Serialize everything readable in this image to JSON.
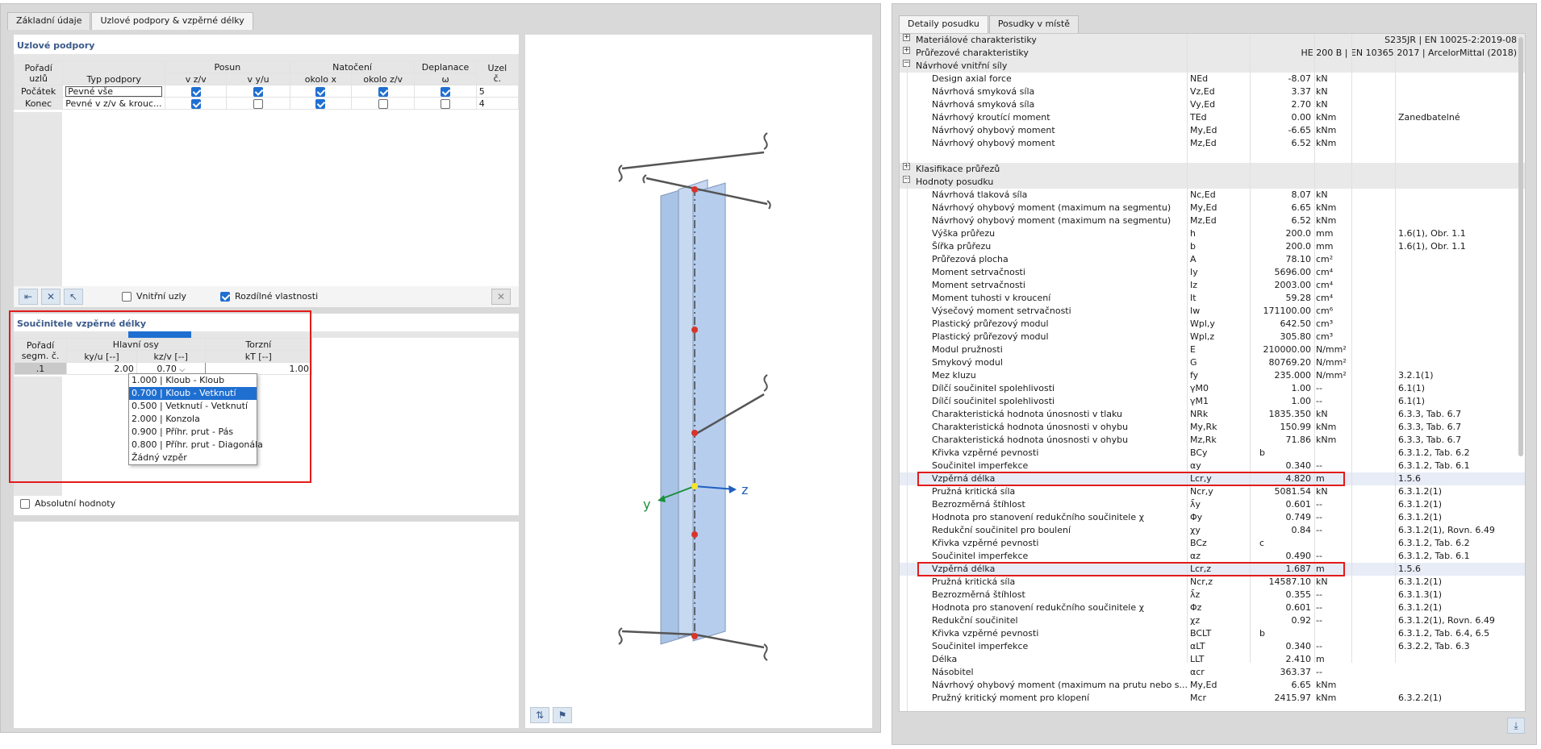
{
  "left": {
    "tabs": [
      "Základní údaje",
      "Uzlové podpory & vzpěrné délky"
    ],
    "supports_section_title": "Uzlové podpory",
    "supports_header": {
      "order": "Pořadí uzlů",
      "order_l1": "Pořadí",
      "order_l2": "uzlů",
      "type": "Typ podpory",
      "posun": "Posun",
      "natoceni": "Natočení",
      "deplanace": "Deplanace",
      "uzel_l1": "Uzel",
      "uzel_l2": "č.",
      "vzv": "v z/v",
      "vyu": "v y/u",
      "okolox": "okolo x",
      "okolozv": "okolo z/v",
      "omega": "ω"
    },
    "supports_rows": [
      {
        "label": "Počátek",
        "type": "Pevné vše",
        "c1": true,
        "c2": true,
        "c3": true,
        "c4": true,
        "c5": true,
        "node": "5"
      },
      {
        "label": "Konec",
        "type": "Pevné v z/v & krouc...",
        "c1": true,
        "c2": false,
        "c3": true,
        "c4": false,
        "c5": false,
        "node": "4"
      }
    ],
    "inner_nodes_label": "Vnitřní uzly",
    "inner_nodes_checked": false,
    "different_props_label": "Rozdílné vlastnosti",
    "different_props_checked": true,
    "buckling_section_title": "Součinitele vzpěrné délky",
    "buckling_header": {
      "order_l1": "Pořadí",
      "order_l2": "segm. č.",
      "main_axes": "Hlavní osy",
      "torsion": "Torzní",
      "ky": "ky/u [--]",
      "kz": "kz/v [--]",
      "kt": "kT [--]"
    },
    "buckling_row": {
      "no": ".1",
      "ky": "2.00",
      "kz": "0.70",
      "kt": "1.00"
    },
    "dropdown_options": [
      "1.000 | Kloub - Kloub",
      "0.700 | Kloub - Vetknutí",
      "0.500 | Vetknutí - Vetknutí",
      "2.000 | Konzola",
      "0.900 | Příhr. prut - Pás",
      "0.800 | Příhr. prut - Diagonála",
      "Žádný vzpěr"
    ],
    "dropdown_selected_index": 1,
    "absolute_values_label": "Absolutní hodnoty",
    "axis_y": "y",
    "axis_z": "z"
  },
  "right": {
    "tabs": [
      "Detaily posudku",
      "Posudky v místě"
    ],
    "rows": [
      {
        "kind": "group",
        "sign": "+",
        "name": "Materiálové charakteristiky",
        "right": "S235JR | EN 10025-2:2019-08"
      },
      {
        "kind": "group",
        "sign": "+",
        "name": "Průřezové charakteristiky",
        "right": "HE 200 B | EN 10365:2017 | ArcelorMittal (2018)"
      },
      {
        "kind": "group",
        "sign": "−",
        "name": "Návrhové vnitřní síly",
        "right": ""
      },
      {
        "kind": "row",
        "name": "Design axial force",
        "sym": "NEd",
        "val": "-8.07",
        "unit": "kN",
        "note": "",
        "ref": ""
      },
      {
        "kind": "row",
        "name": "Návrhová smyková síla",
        "sym": "Vz,Ed",
        "val": "3.37",
        "unit": "kN",
        "note": "",
        "ref": ""
      },
      {
        "kind": "row",
        "name": "Návrhová smyková síla",
        "sym": "Vy,Ed",
        "val": "2.70",
        "unit": "kN",
        "note": "",
        "ref": ""
      },
      {
        "kind": "row",
        "name": "Návrhový kroutící moment",
        "sym": "TEd",
        "val": "0.00",
        "unit": "kNm",
        "note": "",
        "ref": "Zanedbatelné"
      },
      {
        "kind": "row",
        "name": "Návrhový ohybový moment",
        "sym": "My,Ed",
        "val": "-6.65",
        "unit": "kNm",
        "note": "",
        "ref": ""
      },
      {
        "kind": "row",
        "name": "Návrhový ohybový moment",
        "sym": "Mz,Ed",
        "val": "6.52",
        "unit": "kNm",
        "note": "",
        "ref": ""
      },
      {
        "kind": "blank"
      },
      {
        "kind": "group",
        "sign": "+",
        "name": "Klasifikace průřezů",
        "right": ""
      },
      {
        "kind": "group",
        "sign": "−",
        "name": "Hodnoty posudku",
        "right": ""
      },
      {
        "kind": "row",
        "name": "Návrhová tlaková síla",
        "sym": "Nc,Ed",
        "val": "8.07",
        "unit": "kN",
        "note": "",
        "ref": ""
      },
      {
        "kind": "row",
        "name": "Návrhový ohybový moment (maximum na segmentu)",
        "sym": "My,Ed",
        "val": "6.65",
        "unit": "kNm",
        "note": "",
        "ref": ""
      },
      {
        "kind": "row",
        "name": "Návrhový ohybový moment (maximum na segmentu)",
        "sym": "Mz,Ed",
        "val": "6.52",
        "unit": "kNm",
        "note": "",
        "ref": ""
      },
      {
        "kind": "row",
        "name": "Výška průřezu",
        "sym": "h",
        "val": "200.0",
        "unit": "mm",
        "note": "",
        "ref": "1.6(1), Obr. 1.1"
      },
      {
        "kind": "row",
        "name": "Šířka průřezu",
        "sym": "b",
        "val": "200.0",
        "unit": "mm",
        "note": "",
        "ref": "1.6(1), Obr. 1.1"
      },
      {
        "kind": "row",
        "name": "Průřezová plocha",
        "sym": "A",
        "val": "78.10",
        "unit": "cm²",
        "note": "",
        "ref": ""
      },
      {
        "kind": "row",
        "name": "Moment setrvačnosti",
        "sym": "Iy",
        "val": "5696.00",
        "unit": "cm⁴",
        "note": "",
        "ref": ""
      },
      {
        "kind": "row",
        "name": "Moment setrvačnosti",
        "sym": "Iz",
        "val": "2003.00",
        "unit": "cm⁴",
        "note": "",
        "ref": ""
      },
      {
        "kind": "row",
        "name": "Moment tuhosti v kroucení",
        "sym": "It",
        "val": "59.28",
        "unit": "cm⁴",
        "note": "",
        "ref": ""
      },
      {
        "kind": "row",
        "name": "Výsečový moment setrvačnosti",
        "sym": "Iw",
        "val": "171100.00",
        "unit": "cm⁶",
        "note": "",
        "ref": ""
      },
      {
        "kind": "row",
        "name": "Plastický průřezový modul",
        "sym": "Wpl,y",
        "val": "642.50",
        "unit": "cm³",
        "note": "",
        "ref": ""
      },
      {
        "kind": "row",
        "name": "Plastický průřezový modul",
        "sym": "Wpl,z",
        "val": "305.80",
        "unit": "cm³",
        "note": "",
        "ref": ""
      },
      {
        "kind": "row",
        "name": "Modul pružnosti",
        "sym": "E",
        "val": "210000.00",
        "unit": "N/mm²",
        "note": "",
        "ref": ""
      },
      {
        "kind": "row",
        "name": "Smykový modul",
        "sym": "G",
        "val": "80769.20",
        "unit": "N/mm²",
        "note": "",
        "ref": ""
      },
      {
        "kind": "row",
        "name": "Mez kluzu",
        "sym": "fy",
        "val": "235.000",
        "unit": "N/mm²",
        "note": "",
        "ref": "3.2.1(1)"
      },
      {
        "kind": "row",
        "name": "Dílčí součinitel spolehlivosti",
        "sym": "γM0",
        "val": "1.00",
        "unit": "--",
        "note": "",
        "ref": "6.1(1)"
      },
      {
        "kind": "row",
        "name": "Dílčí součinitel spolehlivosti",
        "sym": "γM1",
        "val": "1.00",
        "unit": "--",
        "note": "",
        "ref": "6.1(1)"
      },
      {
        "kind": "row",
        "name": "Charakteristická hodnota únosnosti v tlaku",
        "sym": "NRk",
        "val": "1835.350",
        "unit": "kN",
        "note": "",
        "ref": "6.3.3, Tab. 6.7"
      },
      {
        "kind": "row",
        "name": "Charakteristická hodnota únosnosti v ohybu",
        "sym": "My,Rk",
        "val": "150.99",
        "unit": "kNm",
        "note": "",
        "ref": "6.3.3, Tab. 6.7"
      },
      {
        "kind": "row",
        "name": "Charakteristická hodnota únosnosti v ohybu",
        "sym": "Mz,Rk",
        "val": "71.86",
        "unit": "kNm",
        "note": "",
        "ref": "6.3.3, Tab. 6.7"
      },
      {
        "kind": "row",
        "name": "Křivka vzpěrné pevnosti",
        "sym": "BCy",
        "val": "",
        "unit": "",
        "note": "b",
        "ref": "6.3.1.2, Tab. 6.2"
      },
      {
        "kind": "row",
        "name": "Součinitel imperfekce",
        "sym": "αy",
        "val": "0.340",
        "unit": "--",
        "note": "",
        "ref": "6.3.1.2, Tab. 6.1"
      },
      {
        "kind": "row",
        "name": "Vzpěrná délka",
        "sym": "Lcr,y",
        "val": "4.820",
        "unit": "m",
        "note": "",
        "ref": "1.5.6",
        "hl": true
      },
      {
        "kind": "row",
        "name": "Pružná kritická síla",
        "sym": "Ncr,y",
        "val": "5081.54",
        "unit": "kN",
        "note": "",
        "ref": "6.3.1.2(1)"
      },
      {
        "kind": "row",
        "name": "Bezrozměrná štíhlost",
        "sym": "λ̄y",
        "val": "0.601",
        "unit": "--",
        "note": "",
        "ref": "6.3.1.2(1)"
      },
      {
        "kind": "row",
        "name": "Hodnota pro stanovení redukčního součinitele χ",
        "sym": "Φy",
        "val": "0.749",
        "unit": "--",
        "note": "",
        "ref": "6.3.1.2(1)"
      },
      {
        "kind": "row",
        "name": "Redukční součinitel pro boulení",
        "sym": "χy",
        "val": "0.84",
        "unit": "--",
        "note": "",
        "ref": "6.3.1.2(1), Rovn. 6.49"
      },
      {
        "kind": "row",
        "name": "Křivka vzpěrné pevnosti",
        "sym": "BCz",
        "val": "",
        "unit": "",
        "note": "c",
        "ref": "6.3.1.2, Tab. 6.2"
      },
      {
        "kind": "row",
        "name": "Součinitel imperfekce",
        "sym": "αz",
        "val": "0.490",
        "unit": "--",
        "note": "",
        "ref": "6.3.1.2, Tab. 6.1"
      },
      {
        "kind": "row",
        "name": "Vzpěrná délka",
        "sym": "Lcr,z",
        "val": "1.687",
        "unit": "m",
        "note": "",
        "ref": "1.5.6",
        "hl": true
      },
      {
        "kind": "row",
        "name": "Pružná kritická síla",
        "sym": "Ncr,z",
        "val": "14587.10",
        "unit": "kN",
        "note": "",
        "ref": "6.3.1.2(1)"
      },
      {
        "kind": "row",
        "name": "Bezrozměrná štíhlost",
        "sym": "λ̄z",
        "val": "0.355",
        "unit": "--",
        "note": "",
        "ref": "6.3.1.3(1)"
      },
      {
        "kind": "row",
        "name": "Hodnota pro stanovení redukčního součinitele χ",
        "sym": "Φz",
        "val": "0.601",
        "unit": "--",
        "note": "",
        "ref": "6.3.1.2(1)"
      },
      {
        "kind": "row",
        "name": "Redukční součinitel",
        "sym": "χz",
        "val": "0.92",
        "unit": "--",
        "note": "",
        "ref": "6.3.1.2(1), Rovn. 6.49"
      },
      {
        "kind": "row",
        "name": "Křivka vzpěrné pevnosti",
        "sym": "BCLT",
        "val": "",
        "unit": "",
        "note": "b",
        "ref": "6.3.1.2, Tab. 6.4, 6.5"
      },
      {
        "kind": "row",
        "name": "Součinitel imperfekce",
        "sym": "αLT",
        "val": "0.340",
        "unit": "--",
        "note": "",
        "ref": "6.3.2.2, Tab. 6.3"
      },
      {
        "kind": "row",
        "name": "Délka",
        "sym": "LLT",
        "val": "2.410",
        "unit": "m",
        "note": "",
        "ref": ""
      },
      {
        "kind": "row",
        "name": "Násobitel",
        "sym": "αcr",
        "val": "363.37",
        "unit": "--",
        "note": "",
        "ref": ""
      },
      {
        "kind": "row",
        "name": "Návrhový ohybový moment (maximum na prutu nebo s...",
        "sym": "My,Ed",
        "val": "6.65",
        "unit": "kNm",
        "note": "",
        "ref": ""
      },
      {
        "kind": "row",
        "name": "Pružný kritický moment pro klopení",
        "sym": "Mcr",
        "val": "2415.97",
        "unit": "kNm",
        "note": "",
        "ref": "6.3.2.2(1)"
      }
    ]
  }
}
